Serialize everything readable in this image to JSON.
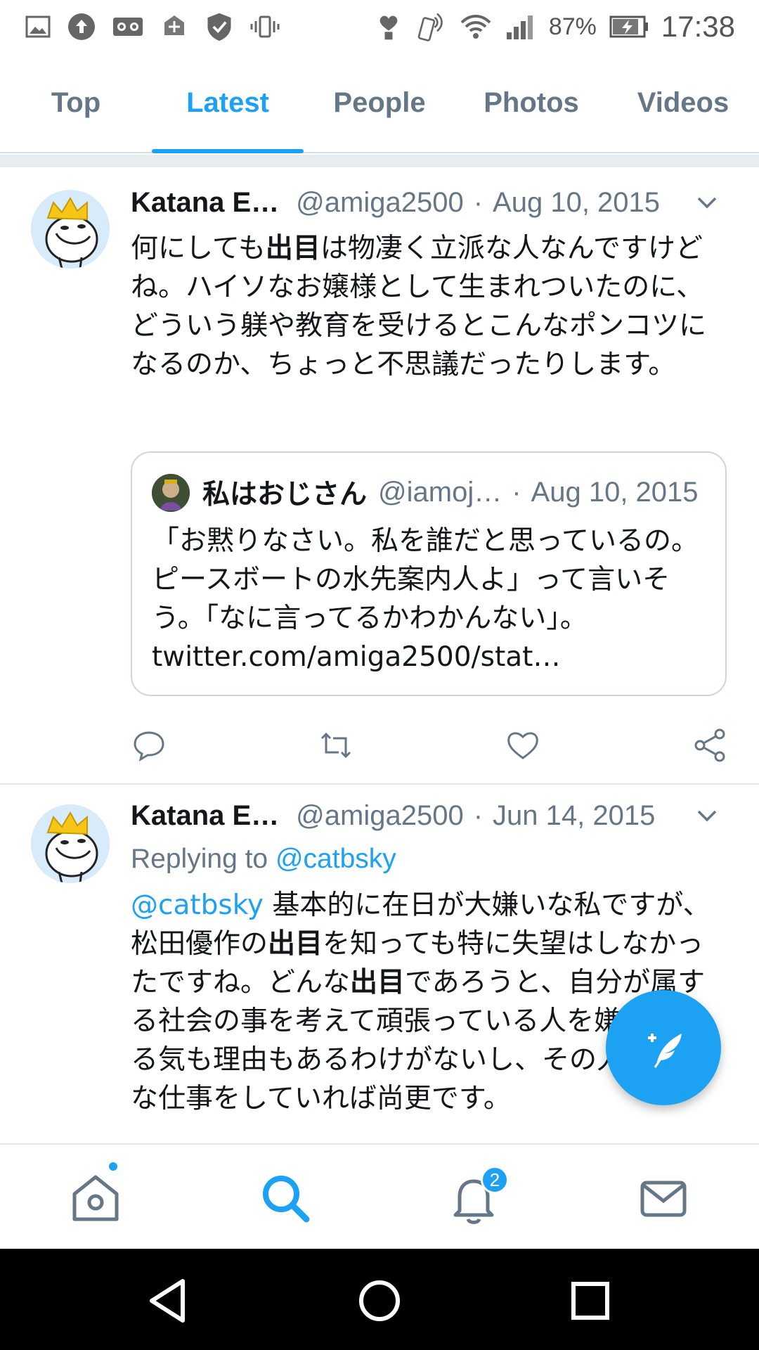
{
  "status_bar": {
    "battery": "87%",
    "time": "17:38"
  },
  "tabs": [
    {
      "label": "Top",
      "active": false
    },
    {
      "label": "Latest",
      "active": true
    },
    {
      "label": "People",
      "active": false
    },
    {
      "label": "Photos",
      "active": false
    },
    {
      "label": "Videos",
      "active": false
    }
  ],
  "tweets": [
    {
      "name": "Katana E…",
      "handle": "@amiga2500",
      "separator": "·",
      "date": "Aug 10, 2015",
      "text_segments": [
        "何にしても",
        "出目",
        "は物凄く立派な人なんですけどね。ハイソなお嬢様として生まれついたのに、どういう躾や教育を受けるとこんなポンコツになるのか、ちょっと不思議だったりします。"
      ],
      "quote": {
        "name": "私はおじさん",
        "handle": "@iamoj…",
        "separator": "·",
        "date": "Aug 10, 2015",
        "text": "「お黙りなさい。私を誰だと思っているの。ピースボートの水先案内人よ」って言いそう。「なに言ってるかわかんない」。 twitter.com/amiga2500/stat…"
      }
    },
    {
      "name": "Katana E…",
      "handle": "@amiga2500",
      "separator": "·",
      "date": "Jun 14, 2015",
      "replying_prefix": "Replying to ",
      "replying_to": "@catbsky",
      "mention": "@catbsky",
      "text_segments": [
        " 基本的に在日が大嫌いな私ですが、松田優作の",
        "出目",
        "を知っても特に失望はしなかったですね。どんな",
        "出目",
        "であろうと、自分が属する社会の事を考えて頑張っている人を嫌いになる気も理由もあるわけがないし、その人が立派な仕事をしていれば尚更です。"
      ]
    }
  ],
  "bottom_nav": {
    "notification_count": "2"
  },
  "colors": {
    "accent": "#1da1f2",
    "secondary_text": "#657786",
    "primary_text": "#14171a"
  }
}
